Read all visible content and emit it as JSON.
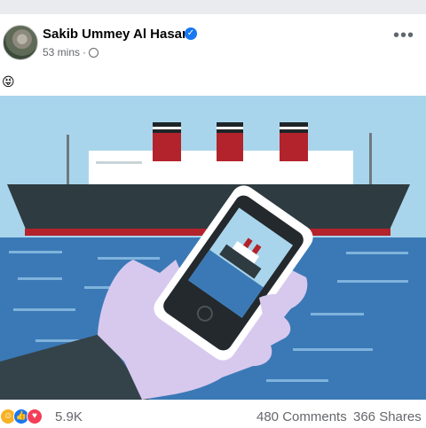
{
  "post": {
    "author": "Sakib Ummey Al Hasan",
    "time": "53 mins",
    "separator": "·",
    "caption_emoji": "😝",
    "more_label": "•••"
  },
  "icons": {
    "verified": "verified-badge-icon",
    "privacy": "globe-icon",
    "more": "more-options-icon",
    "reactions": [
      "haha-reaction-icon",
      "like-reaction-icon",
      "love-reaction-icon"
    ]
  },
  "engagement": {
    "reaction_count": "5.9K",
    "comments": "480 Comments",
    "shares": "366 Shares"
  },
  "colors": {
    "accent": "#1877f2",
    "sky": "#a9d5ec",
    "sea": "#3b79b6",
    "hull": "#2e3b40",
    "funnel_red": "#b3232b",
    "sleeve": "#34434a",
    "hand": "#d7c9ee"
  }
}
